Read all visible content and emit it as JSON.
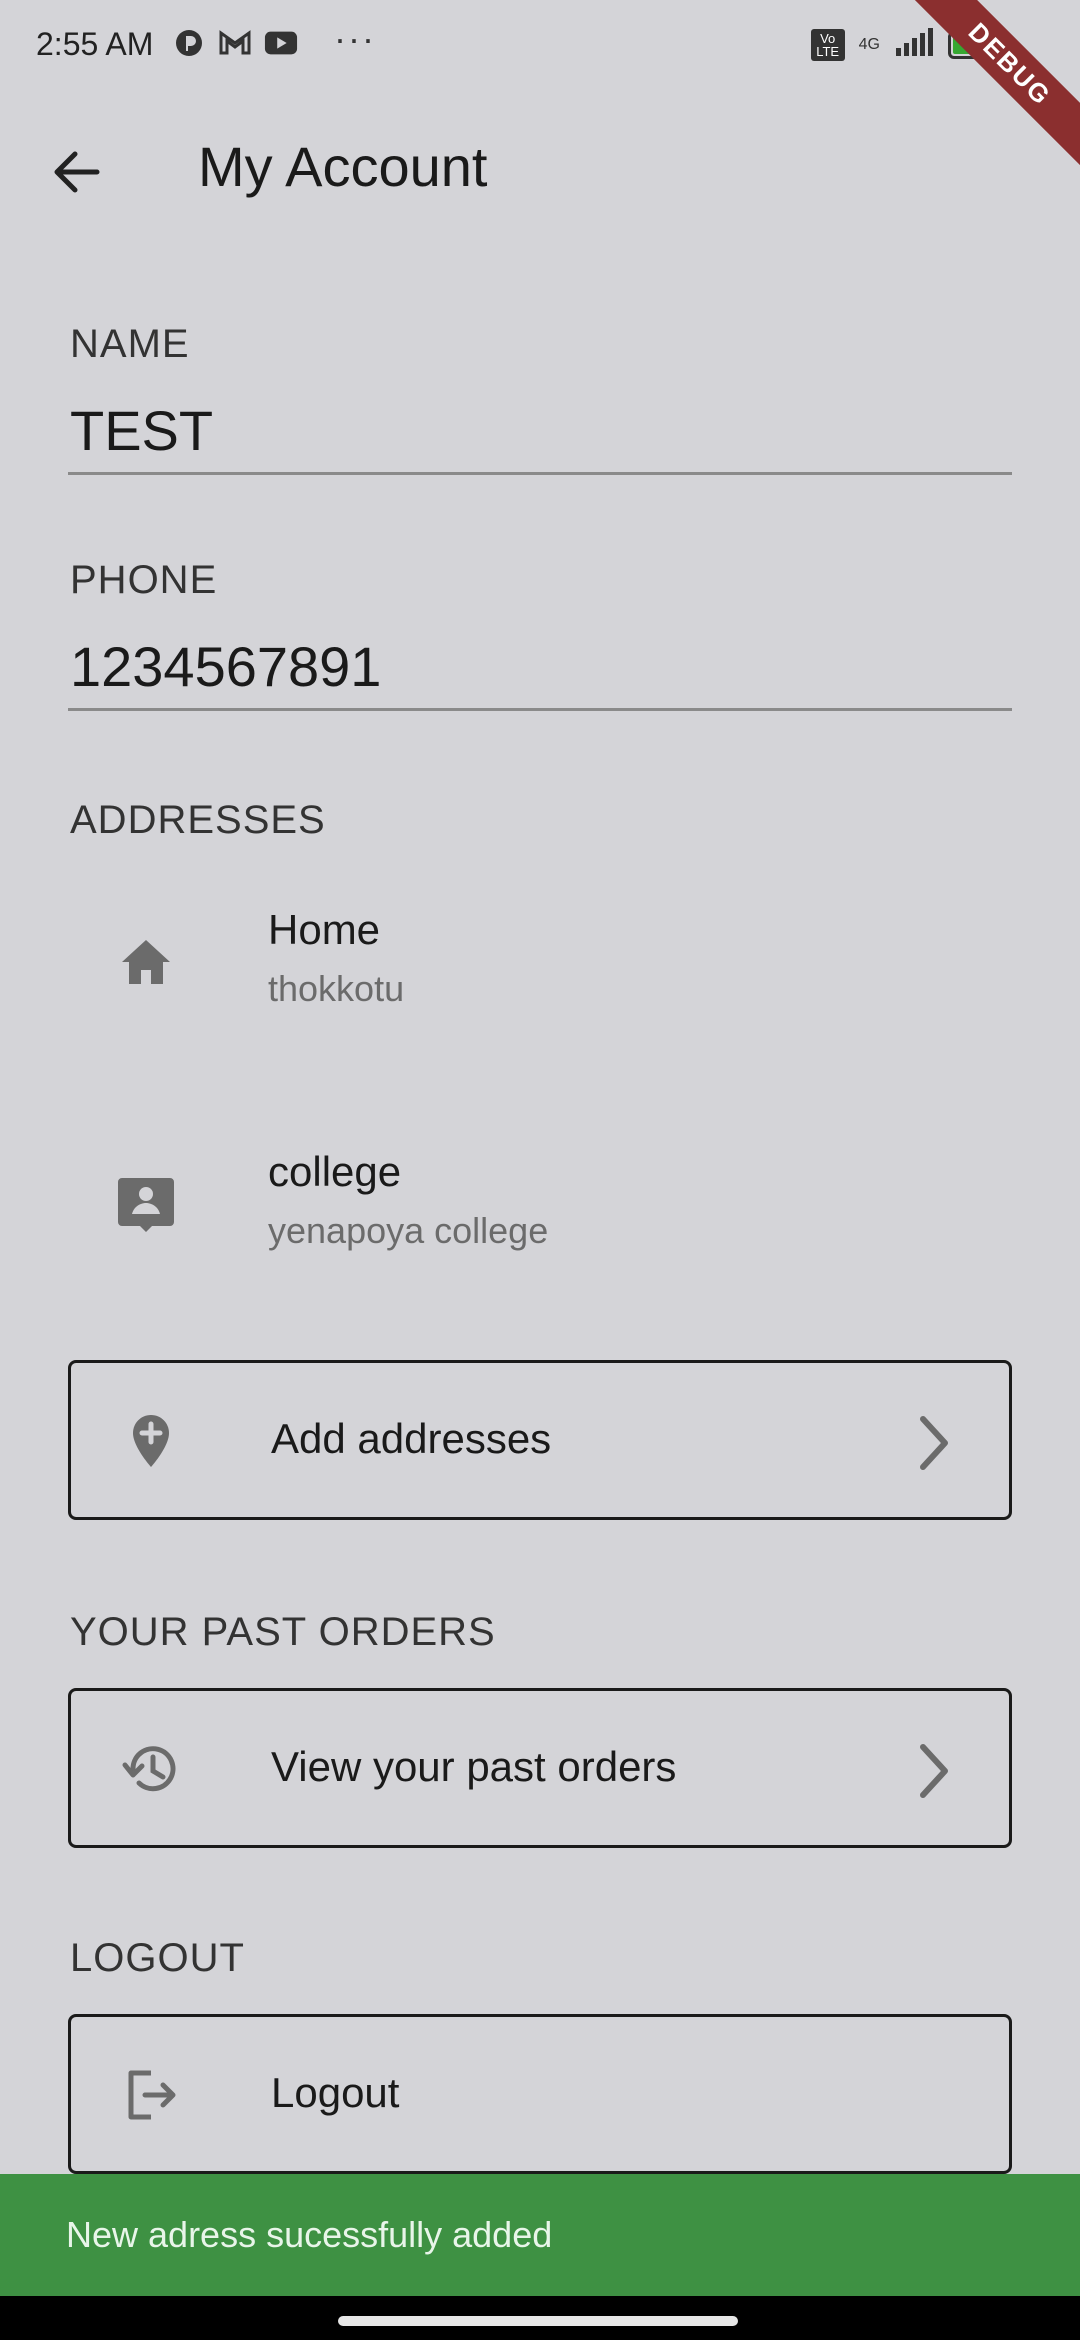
{
  "status": {
    "time": "2:55 AM",
    "dots": "···",
    "volte": "Vo LTE",
    "network": "4G",
    "battery": "45",
    "battery_level": 0.45
  },
  "debug_banner": "DEBUG",
  "app_bar": {
    "title": "My Account"
  },
  "name": {
    "label": "NAME",
    "value": "TEST"
  },
  "phone": {
    "label": "PHONE",
    "value": "1234567891"
  },
  "addresses": {
    "label": "ADDRESSES",
    "items": [
      {
        "title": "Home",
        "subtitle": "thokkotu",
        "icon": "home-icon"
      },
      {
        "title": "college",
        "subtitle": "yenapoya college",
        "icon": "contact-card-icon"
      }
    ],
    "add_label": "Add addresses"
  },
  "past_orders": {
    "label": "YOUR PAST ORDERS",
    "button_label": "View your past orders"
  },
  "logout": {
    "label": "LOGOUT",
    "button_label": "Logout"
  },
  "snackbar": {
    "message": "New adress sucessfully added",
    "color": "#3e9143"
  },
  "colors": {
    "background": "#d4d4d8",
    "debug_ribbon": "#8b2f2f"
  }
}
